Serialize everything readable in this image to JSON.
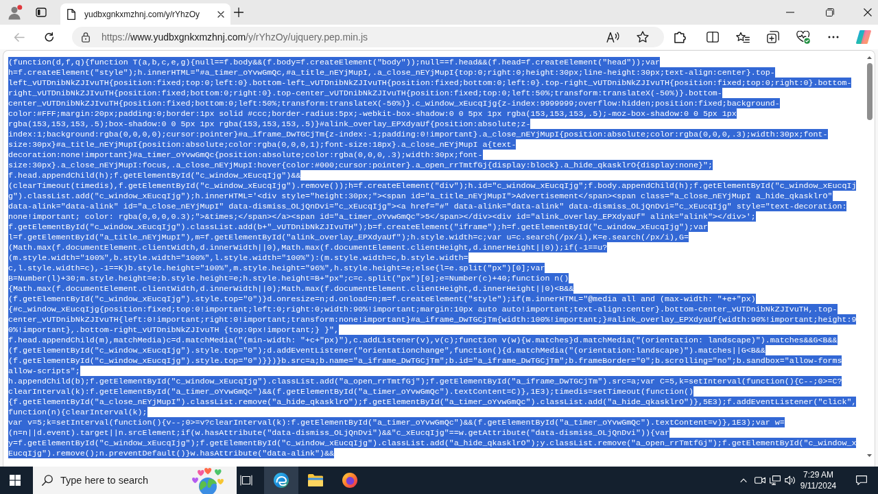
{
  "browser": {
    "tabs": [
      {
        "title": "yudbxgnkxmzhnj.com/y/rYhzOy",
        "selected": true
      }
    ],
    "toolbar": {
      "back": {
        "disabled": true
      },
      "address": {
        "scheme": "https://",
        "host": "www.yudbxgnkxmzhnj.com",
        "path": "/y/rYhzOy/ujquery.pep.min.js"
      }
    }
  },
  "document": {
    "selected": true,
    "lines": [
      "(function(d,f,q){function T(a,b,c,e,g){null==f.body&&(f.body=f.createElement(\"body\"));null==f.head&&(f.head=f.createElement(\"head\"));var",
      "h=f.createElement(\"style\");h.innerHTML=\"#a_timer_oYvwGmQc,#a_title_nEYjMupI,.a_close_nEYjMupI{top:0;right:0;height:30px;line-height:30px;text-align:center}.top-",
      "left_vUTDnibNkZJIvuTH{position:fixed;top:0;left:0}.bottom-left_vUTDnibNkZJIvuTH{position:fixed;bottom:0;left:0}.top-right_vUTDnibNkZJIvuTH{position:fixed;top:0;right:0}.bottom-",
      "right_vUTDnibNkZJIvuTH{position:fixed;bottom:0;right:0}.top-center_vUTDnibNkZJIvuTH{position:fixed;top:0;left:50%;transform:translateX(-50%)}.bottom-",
      "center_vUTDnibNkZJIvuTH{position:fixed;bottom:0;left:50%;transform:translateX(-50%)}.c_window_xEucqIjg{z-index:9999999;overflow:hidden;position:fixed;background-",
      "color:#FFF;margin:20px;padding:0;border:1px solid #ccc;border-radius:5px;-webkit-box-shadow:0 0 5px 1px rgba(153,153,153,.5);-moz-box-shadow:0 0 5px 1px",
      "rgba(153,153,153,.5);box-shadow:0 0 5px 1px rgba(153,153,153,.5)}#alink_overlay_EPXdyaUf{position:absolute;z-",
      "index:1;background:rgba(0,0,0,0);cursor:pointer}#a_iframe_DwTGCjTm{z-index:-1;padding:0!important}.a_close_nEYjMupI{position:absolute;color:rgba(0,0,0,.3);width:30px;font-",
      "size:30px}#a_title_nEYjMupI{position:absolute;color:rgba(0,0,0,1);font-size:18px}.a_close_nEYjMupI a{text-",
      "decoration:none!important}#a_timer_oYvwGmQc{position:absolute;color:rgba(0,0,0,.3);width:30px;font-",
      "size:30px}.a_close_nEYjMupI:focus,.a_close_nEYjMupI:hover{color:#000;cursor:pointer}.a_open_rrTmtfGj{display:block}.a_hide_qkasklrO{display:none}\";",
      "f.head.appendChild(h);f.getElementById(\"c_window_xEucqIjg\")&&",
      "(clearTimeout(timedis),f.getElementById(\"c_window_xEucqIjg\").remove());h=f.createElement(\"div\");h.id=\"c_window_xEucqIjg\";f.body.appendChild(h);f.getElementById(\"c_window_xEucqIj",
      "g\").classList.add(\"c_window_xEucqIjg\");h.innerHTML='<div style=\"height:30px;\"><span id=\"a_title_nEYjMupI\">Advertisement</span><span class=\"a_close_nEYjMupI a_hide_qkasklrO\"",
      "data-alink=\"data-alink\" id=\"a_close_nEYjMupI\" data-dismiss_OLjQnDvi=\"c_xEucqIjg\"><a href=\"#\" data-alink=\"data-alink\" data-dismiss_OLjQnDvi=\"c_xEucqIjg\" style=\"text-decoration:",
      "none!important; color: rgba(0,0,0,0.3);\">&times;</span></a><span id=\"a_timer_oYvwGmQc\">5</span></div><div id=\"alink_overlay_EPXdyaUf\" alink=\"alink\"></div>';",
      "f.getElementById(\"c_window_xEucqIjg\").classList.add(b+\"_vUTDnibNkZJIvuTH\");b=f.createElement(\"iframe\");h=f.getElementById(\"c_window_xEucqIjg\");var",
      "l=f.getElementById(\"a_title_nEYjMupI\"),m=f.getElementById(\"alink_overlay_EPXdyaUf\");h.style.width=c;var u=c.search(/px/i),K=e.search(/px/i),G=",
      "(Math.max(f.documentElement.clientWidth,d.innerWidth||0),Math.max(f.documentElement.clientHeight,d.innerHeight||0));if(-1==u?",
      "(m.style.width=\"100%\",b.style.width=\"100%\",l.style.width=\"100%\"):(m.style.width=c,b.style.width=",
      "c,l.style.width=c),-1==K)b.style.height=\"100%\",m.style.height=\"96%\",h.style.height=e;else{l=e.split(\"px\")[0];var",
      "B=Number(l)+30;m.style.height=e;b.style.height=e;h.style.height=B+\"px\";c=c.split(\"px\")[0];e=Number(c)+40;function n()",
      "{Math.max(f.documentElement.clientWidth,d.innerWidth||0);Math.max(f.documentElement.clientHeight,d.innerHeight||0)<B&&",
      "(f.getElementById(\"c_window_xEucqIjg\").style.top=\"0\")}d.onresize=n;d.onload=n;m=f.createElement(\"style\");if(m.innerHTML=\"@media all and (max-width: \"+e+\"px)",
      "{#c_window_xEucqIjg{position:fixed;top:0!important;left:0;right:0;width:90%!important;margin:10px auto auto!important;text-align:center}.bottom-center_vUTDnibNkZJIvuTH,.top-",
      "center_vUTDnibNkZJIvuTH{left:0!important;right:0!important;transform:none!important}#a_iframe_DwTGCjTm{width:100%!important;}#alink_overlay_EPXdyaUf{width:90%!important;height:9",
      "0%!important},.bottom-right_vUTDnibNkZJIvuTH {top:0px!important;} }\",",
      "f.head.appendChild(m),matchMedia)c=d.matchMedia(\"(min-width: \"+c+\"px)\"),c.addListener(v),v(c);function v(w){w.matches}d.matchMedia(\"(orientation: landscape)\").matches&&G<B&&",
      "(f.getElementById(\"c_window_xEucqIjg\").style.top=\"0\");d.addEventListener(\"orientationchange\",function(){d.matchMedia(\"(orientation:landscape)\").matches||G<B&&",
      "(f.getElementById(\"c_window_xEucqIjg\").style.top=\"0\")}})}b.src=a;b.name=\"a_iframe_DwTGCjTm\";b.id=\"a_iframe_DwTGCjTm\";b.frameBorder=\"0\";b.scrolling=\"no\";b.sandbox=\"allow-forms",
      "allow-scripts\";",
      "h.appendChild(b);f.getElementById(\"c_window_xEucqIjg\").classList.add(\"a_open_rrTmtfGj\");f.getElementById(\"a_iframe_DwTGCjTm\").src=a;var C=5,k=setInterval(function(){C--;0>=C?",
      "clearInterval(k):f.getElementById(\"a_timer_oYvwGmQc\")&&(f.getElementById(\"a_timer_oYvwGmQc\").textContent=C)},1E3);timedis=setTimeout(function()",
      "{f.getElementById(\"a_close_nEYjMupI\").classList.remove(\"a_hide_qkasklrO\");f.getElementById(\"a_timer_oYvwGmQc\").classList.add(\"a_hide_qkasklrO\")},5E3);f.addEventListener(\"click\",",
      "function(n){clearInterval(k);",
      "var v=5;k=setInterval(function(){v--;0>=v?clearInterval(k):f.getElementById(\"a_timer_oYvwGmQc\")&&(f.getElementById(\"a_timer_oYvwGmQc\").textContent=v)},1E3);var w=",
      "(n=n||d.event).target||n.srcElement;if(w.hasAttribute(\"data-dismiss_OLjQnDvi\")&&\"c_xEucqIjg\"==w.getAttribute(\"data-dismiss_OLjQnDvi\")){var",
      "y=f.getElementById(\"c_window_xEucqIjg\");f.getElementById(\"c_window_xEucqIjg\").classList.add(\"a_hide_qkasklrO\");y.classList.remove(\"a_open_rrTmtfGj\");f.getElementById(\"c_window_x",
      "EucqIjg\").remove();n.preventDefault()}w.hasAttribute(\"data-alink\")&&"
    ]
  },
  "taskbar": {
    "search": {
      "placeholder": "Type here to search"
    },
    "apps": [
      {
        "kind": "edge",
        "selected": true
      },
      {
        "kind": "explorer",
        "selected": false
      },
      {
        "kind": "firefox",
        "selected": false
      }
    ],
    "clock": {
      "time": "7:29 AM",
      "date": "9/11/2024"
    }
  }
}
